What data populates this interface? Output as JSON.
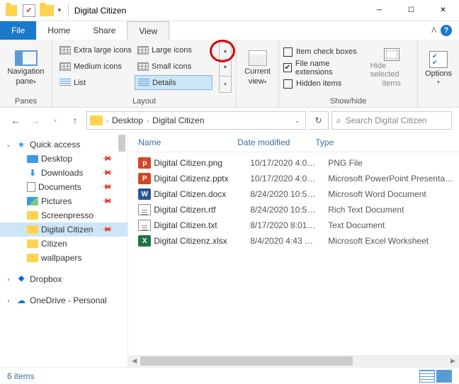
{
  "titlebar": {
    "title": "Digital Citizen"
  },
  "tabs": {
    "file": "File",
    "home": "Home",
    "share": "Share",
    "view": "View"
  },
  "ribbon": {
    "panes": {
      "label": "Panes",
      "nav": "Navigation",
      "nav2": "pane"
    },
    "layout": {
      "label": "Layout",
      "xlarge": "Extra large icons",
      "large": "Large icons",
      "medium": "Medium icons",
      "small": "Small icons",
      "list": "List",
      "details": "Details"
    },
    "curview": {
      "top": "Current",
      "bot": "view"
    },
    "showhide": {
      "label": "Show/hide",
      "check1": "Item check boxes",
      "check2": "File name extensions",
      "check3": "Hidden items",
      "hide1": "Hide selected",
      "hide2": "items"
    },
    "options": "Options"
  },
  "breadcrumb": {
    "p1": "Desktop",
    "p2": "Digital Citizen"
  },
  "search": {
    "placeholder": "Search Digital Citizen"
  },
  "tree": {
    "quick": "Quick access",
    "desktop": "Desktop",
    "downloads": "Downloads",
    "documents": "Documents",
    "pictures": "Pictures",
    "screenpresso": "Screenpresso",
    "digitalcitizen": "Digital Citizen",
    "citizen": "Citizen",
    "wallpapers": "wallpapers",
    "dropbox": "Dropbox",
    "onedrive": "OneDrive - Personal"
  },
  "columns": {
    "name": "Name",
    "date": "Date modified",
    "type": "Type"
  },
  "files": [
    {
      "icon": "png",
      "glyph": "p",
      "name": "Digital Citizen.png",
      "date": "10/17/2020 4:0…",
      "type": "PNG File"
    },
    {
      "icon": "pptx",
      "glyph": "P",
      "name": "Digital Citizenz.pptx",
      "date": "10/17/2020 4:0…",
      "type": "Microsoft PowerPoint Presenta…"
    },
    {
      "icon": "docx",
      "glyph": "W",
      "name": "Digital Citizen.docx",
      "date": "8/24/2020 10:5…",
      "type": "Microsoft Word Document"
    },
    {
      "icon": "rtf",
      "glyph": "",
      "name": "Digital Citizen.rtf",
      "date": "8/24/2020 10:5…",
      "type": "Rich Text Document"
    },
    {
      "icon": "txt",
      "glyph": "",
      "name": "Digital Citizen.txt",
      "date": "8/17/2020 8:01…",
      "type": "Text Document"
    },
    {
      "icon": "xlsx",
      "glyph": "X",
      "name": "Digital Citizenz.xlsx",
      "date": "8/4/2020 4:43 …",
      "type": "Microsoft Excel Worksheet"
    }
  ],
  "status": {
    "count": "6 items"
  }
}
